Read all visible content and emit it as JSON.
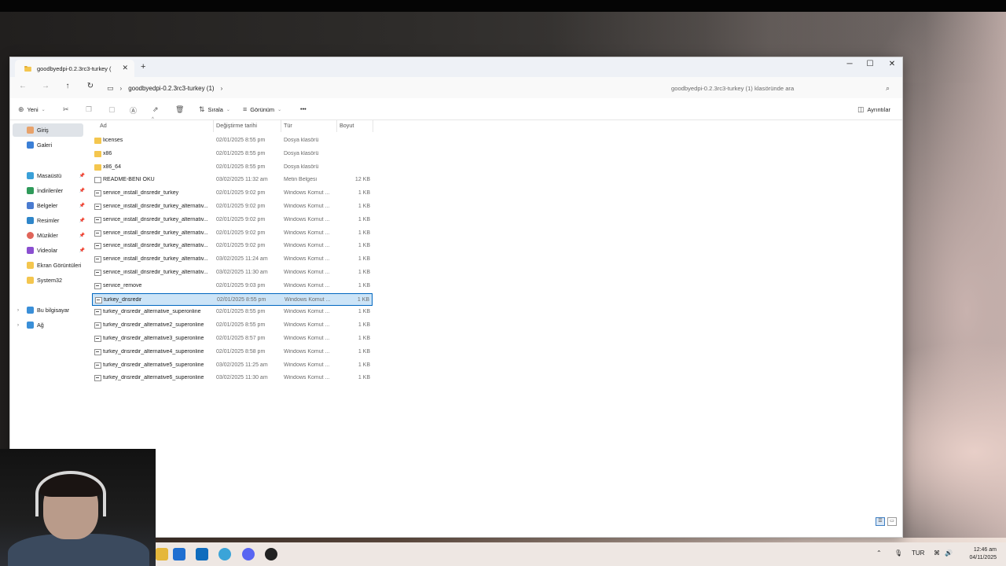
{
  "window": {
    "tab_title": "goodbyedpi-0.2.3rc3-turkey (",
    "minimize": "─",
    "maximize": "☐",
    "close": "✕",
    "new_tab": "+",
    "tab_close": "✕"
  },
  "address": {
    "breadcrumb": "goodbyedpi-0.2.3rc3-turkey (1)",
    "search_placeholder": "goodbyedpi-0.2.3rc3-turkey (1) klasöründe ara"
  },
  "toolbar": {
    "new_label": "Yeni",
    "sort_label": "Sırala",
    "view_label": "Görünüm",
    "more_label": "•••",
    "details_label": "Ayrıntılar"
  },
  "sidebar": {
    "items": [
      {
        "label": "Giriş",
        "icon": "home-icon",
        "color": "#e8a26a"
      },
      {
        "label": "Galeri",
        "icon": "gallery-icon",
        "color": "#3b7fd6"
      },
      {
        "label": "Masaüstü",
        "icon": "desktop-icon",
        "color": "#3aa0d8"
      },
      {
        "label": "İndirilenler",
        "icon": "download-icon",
        "color": "#2f9a5a"
      },
      {
        "label": "Belgeler",
        "icon": "documents-icon",
        "color": "#4a7bd0"
      },
      {
        "label": "Resimler",
        "icon": "pictures-icon",
        "color": "#2f86c9"
      },
      {
        "label": "Müzikler",
        "icon": "music-icon",
        "color": "#e0655a"
      },
      {
        "label": "Videolar",
        "icon": "videos-icon",
        "color": "#8a4fd0"
      },
      {
        "label": "Ekran Görüntüleri",
        "icon": "folder-icon",
        "color": "#f4c64e"
      },
      {
        "label": "System32",
        "icon": "folder-icon",
        "color": "#f4c64e"
      },
      {
        "label": "Bu bilgisayar",
        "icon": "this-pc-icon",
        "color": "#3a8fd8"
      },
      {
        "label": "Ağ",
        "icon": "network-icon",
        "color": "#3a8fd8"
      }
    ]
  },
  "columns": {
    "name": "Ad",
    "date": "Değiştirme tarihi",
    "type": "Tür",
    "size": "Boyut"
  },
  "files": [
    {
      "name": "licenses",
      "date": "02/01/2025 8:55 pm",
      "type": "Dosya klasörü",
      "size": "",
      "kind": "folder"
    },
    {
      "name": "x86",
      "date": "02/01/2025 8:55 pm",
      "type": "Dosya klasörü",
      "size": "",
      "kind": "folder"
    },
    {
      "name": "x86_64",
      "date": "02/01/2025 8:55 pm",
      "type": "Dosya klasörü",
      "size": "",
      "kind": "folder"
    },
    {
      "name": "README-BENİ OKU",
      "date": "03/02/2025 11:32 am",
      "type": "Metin Belgesi",
      "size": "12 KB",
      "kind": "doc"
    },
    {
      "name": "service_install_dnsredir_turkey",
      "date": "02/01/2025 9:02 pm",
      "type": "Windows Komut ...",
      "size": "1 KB",
      "kind": "cmd"
    },
    {
      "name": "service_install_dnsredir_turkey_alternativ...",
      "date": "02/01/2025 9:02 pm",
      "type": "Windows Komut ...",
      "size": "1 KB",
      "kind": "cmd"
    },
    {
      "name": "service_install_dnsredir_turkey_alternativ...",
      "date": "02/01/2025 9:02 pm",
      "type": "Windows Komut ...",
      "size": "1 KB",
      "kind": "cmd"
    },
    {
      "name": "service_install_dnsredir_turkey_alternativ...",
      "date": "02/01/2025 9:02 pm",
      "type": "Windows Komut ...",
      "size": "1 KB",
      "kind": "cmd"
    },
    {
      "name": "service_install_dnsredir_turkey_alternativ...",
      "date": "02/01/2025 9:02 pm",
      "type": "Windows Komut ...",
      "size": "1 KB",
      "kind": "cmd"
    },
    {
      "name": "service_install_dnsredir_turkey_alternativ...",
      "date": "03/02/2025 11:24 am",
      "type": "Windows Komut ...",
      "size": "1 KB",
      "kind": "cmd"
    },
    {
      "name": "service_install_dnsredir_turkey_alternativ...",
      "date": "03/02/2025 11:30 am",
      "type": "Windows Komut ...",
      "size": "1 KB",
      "kind": "cmd"
    },
    {
      "name": "service_remove",
      "date": "02/01/2025 9:03 pm",
      "type": "Windows Komut ...",
      "size": "1 KB",
      "kind": "cmd"
    },
    {
      "name": "turkey_dnsredir",
      "date": "02/01/2025 8:55 pm",
      "type": "Windows Komut ...",
      "size": "1 KB",
      "kind": "cmd",
      "selected": true
    },
    {
      "name": "turkey_dnsredir_alternative_superonline",
      "date": "02/01/2025 8:55 pm",
      "type": "Windows Komut ...",
      "size": "1 KB",
      "kind": "cmd"
    },
    {
      "name": "turkey_dnsredir_alternative2_superonline",
      "date": "02/01/2025 8:55 pm",
      "type": "Windows Komut ...",
      "size": "1 KB",
      "kind": "cmd"
    },
    {
      "name": "turkey_dnsredir_alternative3_superonline",
      "date": "02/01/2025 8:57 pm",
      "type": "Windows Komut ...",
      "size": "1 KB",
      "kind": "cmd"
    },
    {
      "name": "turkey_dnsredir_alternative4_superonline",
      "date": "02/01/2025 8:58 pm",
      "type": "Windows Komut ...",
      "size": "1 KB",
      "kind": "cmd"
    },
    {
      "name": "turkey_dnsredir_alternative5_superonline",
      "date": "03/02/2025 11:25 am",
      "type": "Windows Komut ...",
      "size": "1 KB",
      "kind": "cmd"
    },
    {
      "name": "turkey_dnsredir_alternative6_superonline",
      "date": "03/02/2025 11:30 am",
      "type": "Windows Komut ...",
      "size": "1 KB",
      "kind": "cmd"
    }
  ],
  "taskbar": {
    "apps": [
      {
        "name": "chrome-icon",
        "color": "#e5b73b"
      },
      {
        "name": "store-icon",
        "color": "#1f6fd1"
      },
      {
        "name": "outlook-icon",
        "color": "#0f6cbd"
      },
      {
        "name": "settings-app-icon",
        "color": "#3ba4d8"
      },
      {
        "name": "discord-icon",
        "color": "#5865f2"
      },
      {
        "name": "github-icon",
        "color": "#222222"
      }
    ],
    "language": "TUR",
    "time": "12:46 am",
    "date": "04/11/2025"
  }
}
